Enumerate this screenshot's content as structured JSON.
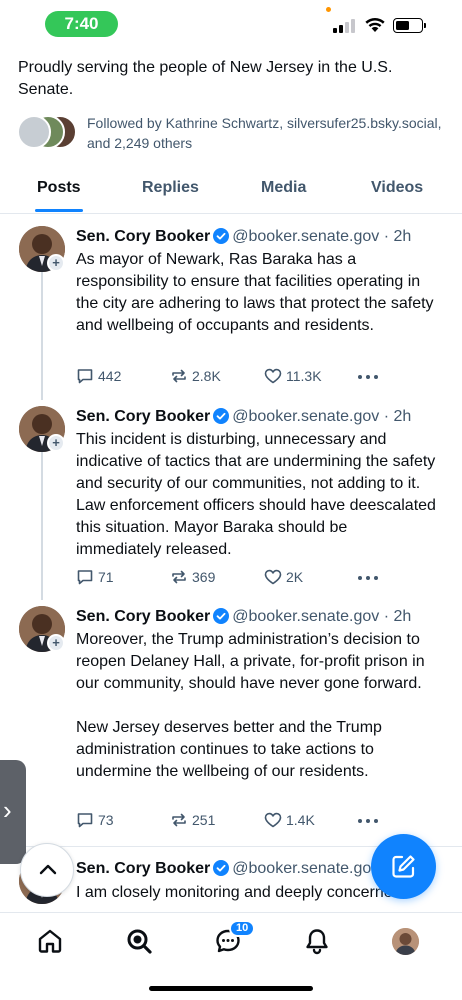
{
  "status_bar": {
    "time": "7:40"
  },
  "profile": {
    "bio": "Proudly serving the people of New Jersey in the U.S. Senate.",
    "followed_by": "Followed by Kathrine Schwartz, silversufer25.bsky.social, and 2,249 others"
  },
  "tabs": [
    {
      "label": "Posts",
      "active": true
    },
    {
      "label": "Replies",
      "active": false
    },
    {
      "label": "Media",
      "active": false
    },
    {
      "label": "Videos",
      "active": false
    }
  ],
  "posts": [
    {
      "author": "Sen. Cory Booker",
      "handle": "@booker.senate.gov",
      "time": "· 2h",
      "text": "As mayor of Newark, Ras Baraka has a responsibility to ensure that facilities operating in the city are adhering to laws that protect the safety and wellbeing of occupants and residents.",
      "replies": "442",
      "reposts": "2.8K",
      "likes": "11.3K"
    },
    {
      "author": "Sen. Cory Booker",
      "handle": "@booker.senate.gov",
      "time": "· 2h",
      "text": "This incident is disturbing, unnecessary and indicative of tactics that are undermining the safety and security of our communities, not adding to it. Law enforcement officers should have deescalated this situation. Mayor Baraka should be immediately released.",
      "replies": "71",
      "reposts": "369",
      "likes": "2K"
    },
    {
      "author": "Sen. Cory Booker",
      "handle": "@booker.senate.gov",
      "time": "· 2h",
      "text": "Moreover, the Trump administration’s decision to reopen Delaney Hall, a private, for-profit prison in our community, should have never gone forward.\n\nNew Jersey deserves better and the Trump administration continues to take actions to undermine the wellbeing of our residents.",
      "replies": "73",
      "reposts": "251",
      "likes": "1.4K"
    },
    {
      "author": "Sen. Cory Booker",
      "handle": "@booker.senate.gov",
      "time": "",
      "text": "I am closely monitoring and deeply concerned",
      "replies": "",
      "reposts": "",
      "likes": ""
    }
  ],
  "bottom_nav": {
    "items": [
      "home-icon",
      "search-icon",
      "chat-icon",
      "bell-icon",
      "profile-avatar"
    ],
    "chat_badge": "10"
  },
  "colors": {
    "accent": "#1083fe",
    "muted_text": "#42576c",
    "status_pill": "#34c759",
    "divider": "#e3e8ee"
  }
}
